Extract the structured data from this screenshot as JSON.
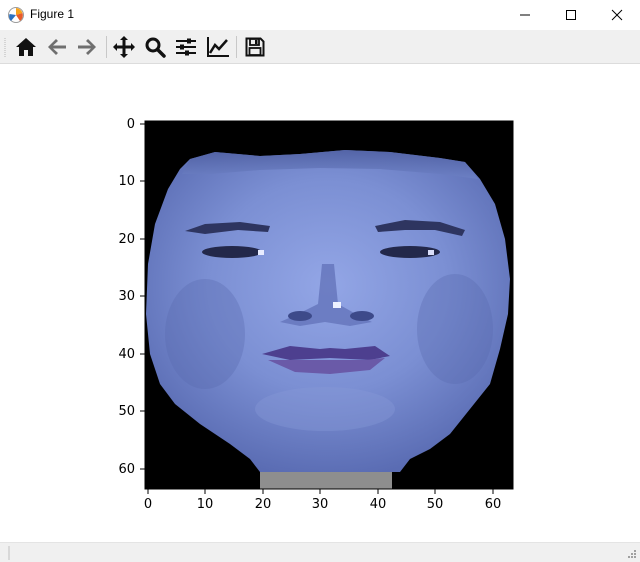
{
  "window": {
    "title": "Figure 1",
    "app_icon": "matplotlib-icon",
    "controls": [
      "minimize-icon",
      "maximize-icon",
      "close-icon"
    ]
  },
  "toolbar": {
    "buttons": [
      {
        "icon": "home-icon",
        "label": "Home"
      },
      {
        "icon": "back-arrow-icon",
        "label": "Back"
      },
      {
        "icon": "forward-arrow-icon",
        "label": "Forward"
      },
      {
        "icon": "pan-icon",
        "label": "Pan"
      },
      {
        "icon": "zoom-icon",
        "label": "Zoom"
      },
      {
        "icon": "subplots-icon",
        "label": "Subplots"
      },
      {
        "icon": "edit-curves-icon",
        "label": "Customize"
      },
      {
        "icon": "save-icon",
        "label": "Save"
      }
    ]
  },
  "chart_data": {
    "type": "image",
    "description_of_content": "64x64 pixel face image (blue-tinted)",
    "xlim": [
      0,
      63
    ],
    "ylim": [
      63,
      0
    ],
    "x_ticks": [
      "0",
      "10",
      "20",
      "30",
      "40",
      "50",
      "60"
    ],
    "y_ticks": [
      "0",
      "10",
      "20",
      "30",
      "40",
      "50",
      "60"
    ],
    "colors": {
      "background": "#000000",
      "face": "#7b8fd3",
      "face_shadow": "#5b6db3",
      "hair": "#3c4c8c",
      "lips": "#6a5aa8",
      "neck_block": "#8e8e8e"
    }
  }
}
